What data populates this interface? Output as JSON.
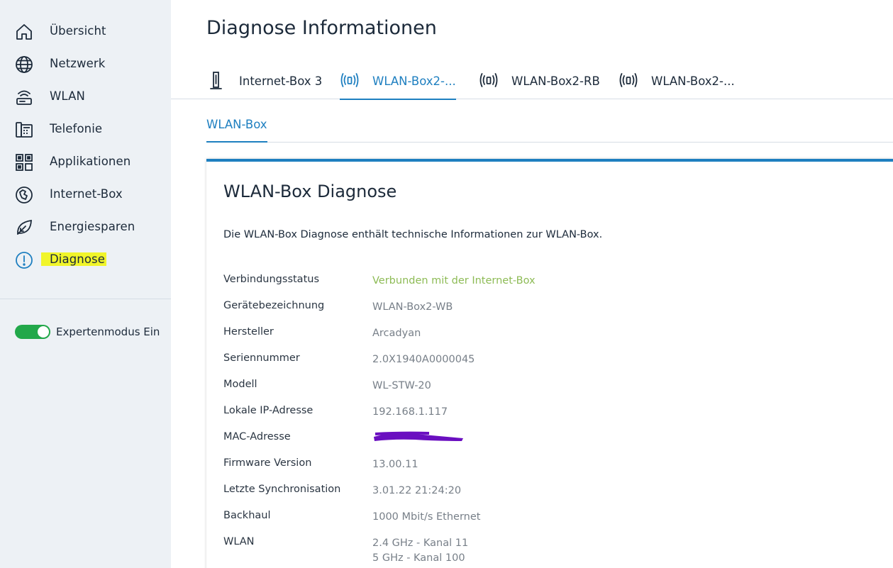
{
  "sidebar": {
    "items": [
      {
        "label": "Übersicht",
        "icon": "home-icon"
      },
      {
        "label": "Netzwerk",
        "icon": "globe-icon"
      },
      {
        "label": "WLAN",
        "icon": "wifi-router-icon"
      },
      {
        "label": "Telefonie",
        "icon": "phone-icon"
      },
      {
        "label": "Applikationen",
        "icon": "apps-grid-icon"
      },
      {
        "label": "Internet-Box",
        "icon": "internet-box-icon"
      },
      {
        "label": "Energiesparen",
        "icon": "leaf-icon"
      },
      {
        "label": "Diagnose",
        "icon": "exclamation-circle-icon"
      }
    ],
    "expert_toggle": {
      "label": "Expertenmodus Ein",
      "on": true
    }
  },
  "page": {
    "title": "Diagnose Informationen"
  },
  "device_tabs": [
    {
      "label": "Internet-Box 3",
      "icon": "internet-box-device-icon",
      "active": false
    },
    {
      "label": "WLAN-Box2-...",
      "icon": "wlan-antenna-icon",
      "active": true
    },
    {
      "label": "WLAN-Box2-RB",
      "icon": "wlan-antenna-icon",
      "active": false
    },
    {
      "label": "WLAN-Box2-...",
      "icon": "wlan-antenna-icon",
      "active": false
    }
  ],
  "sub_tabs": [
    {
      "label": "WLAN-Box"
    }
  ],
  "card": {
    "title": "WLAN-Box Diagnose",
    "description": "Die WLAN-Box Diagnose enthält technische Informationen zur WLAN-Box.",
    "rows": [
      {
        "key": "Verbindungsstatus",
        "value": "Verbunden mit der Internet-Box"
      },
      {
        "key": "Gerätebezeichnung",
        "value": "WLAN-Box2-WB"
      },
      {
        "key": "Hersteller",
        "value": "Arcadyan"
      },
      {
        "key": "Seriennummer",
        "value": "2.0X1940A0000045"
      },
      {
        "key": "Modell",
        "value": "WL-STW-20"
      },
      {
        "key": "Lokale IP-Adresse",
        "value": "192.168.1.117"
      },
      {
        "key": "MAC-Adresse",
        "value": ""
      },
      {
        "key": "Firmware Version",
        "value": "13.00.11"
      },
      {
        "key": "Letzte Synchronisation",
        "value": "3.01.22 21:24:20"
      },
      {
        "key": "Backhaul",
        "value": "1000 Mbit/s Ethernet"
      },
      {
        "key": "WLAN",
        "value": "2.4 GHz - Kanal 11",
        "value2": "5 GHz - Kanal 100"
      }
    ]
  },
  "colors": {
    "accent": "#1e7fc0",
    "status_green": "#8dbb55",
    "toggle_green": "#22a84a",
    "highlight": "#f1f52a",
    "redaction": "#6a0fc0"
  }
}
